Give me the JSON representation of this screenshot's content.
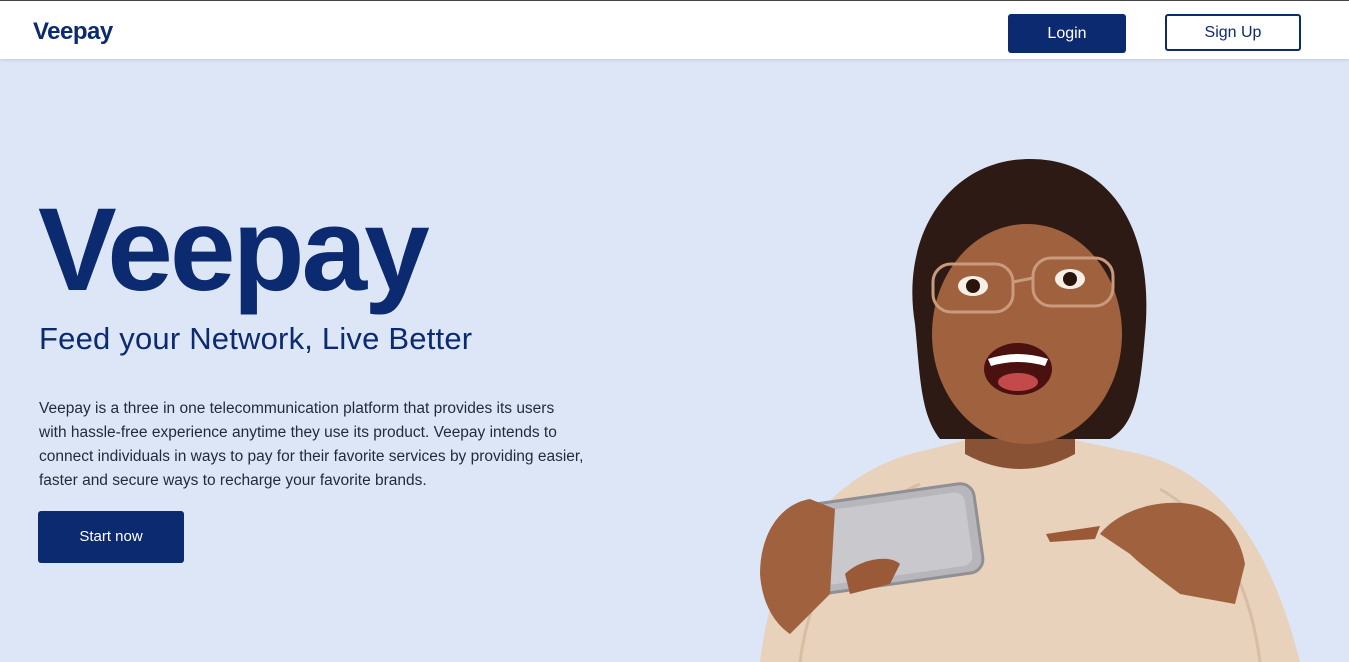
{
  "header": {
    "logo_text": "Veepay",
    "login_label": "Login",
    "signup_label": "Sign Up"
  },
  "hero": {
    "logo_text": "Veepay",
    "tagline": "Feed your Network, Live Better",
    "description": "Veepay is a three in one telecommunication platform that provides its users with hassle-free experience anytime they use its product. Veepay intends to connect individuals in ways to pay for their favorite services by providing easier, faster and secure ways to recharge your favorite brands.",
    "cta_label": "Start now"
  },
  "colors": {
    "brand": "#0b2a6f",
    "hero_background": "#dce6f7",
    "header_background": "#ffffff"
  }
}
